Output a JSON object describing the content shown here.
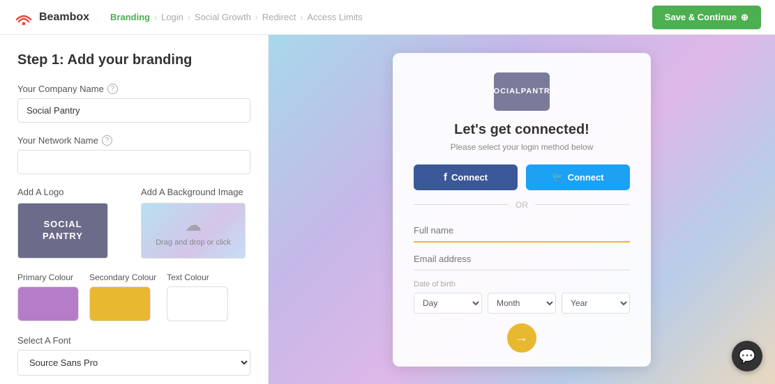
{
  "brand": {
    "name": "Beambox"
  },
  "topnav": {
    "steps": [
      {
        "label": "Branding",
        "active": true
      },
      {
        "label": "Login",
        "active": false
      },
      {
        "label": "Social Growth",
        "active": false
      },
      {
        "label": "Redirect",
        "active": false
      },
      {
        "label": "Access Limits",
        "active": false
      }
    ],
    "save_button": "Save & Continue"
  },
  "left": {
    "title": "Step 1: Add your branding",
    "company_name_label": "Your Company Name",
    "company_name_value": "Social Pantry",
    "network_name_label": "Your Network Name",
    "network_name_placeholder": "",
    "logo_section_label": "Add A Logo",
    "logo_text_line1": "SOCIAL",
    "logo_text_line2": "PANTRY",
    "bg_image_label": "Add A Background Image",
    "bg_image_text": "Drag and drop or click",
    "primary_colour_label": "Primary Colour",
    "secondary_colour_label": "Secondary Colour",
    "text_colour_label": "Text Colour",
    "font_label": "Select A Font",
    "font_value": "Source Sans Pro"
  },
  "preview": {
    "logo_line1": "SOCIAL",
    "logo_line2": "PANTRY",
    "title": "Let's get connected!",
    "subtitle": "Please select your login method below",
    "fb_button": "Connect",
    "tw_button": "Connect",
    "or_text": "OR",
    "full_name_placeholder": "Full name",
    "email_placeholder": "Email address",
    "dob_label": "Date of birth",
    "dob_day": "Day",
    "dob_month": "Month",
    "dob_year": "Year"
  },
  "icons": {
    "beambox_wifi": "📶",
    "chevron": "›",
    "save_arrow": "→",
    "facebook": "f",
    "twitter": "🐦",
    "arrow_right": "→",
    "chat": "💬",
    "cloud": "☁"
  }
}
